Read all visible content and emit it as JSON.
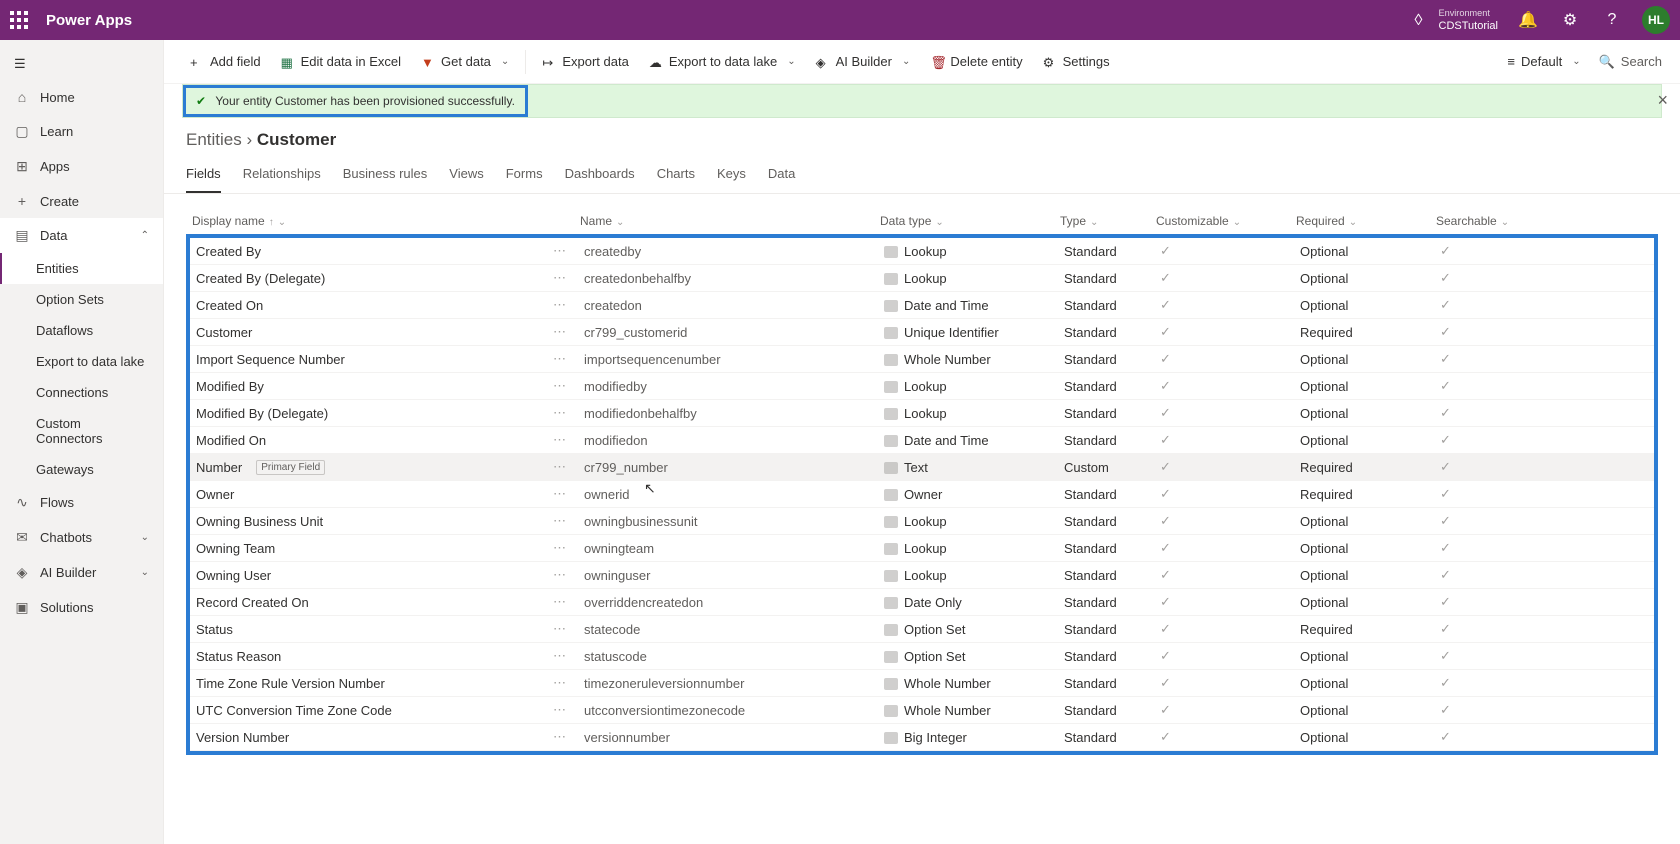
{
  "header": {
    "app_title": "Power Apps",
    "env_label": "Environment",
    "env_name": "CDSTutorial",
    "avatar": "HL"
  },
  "sidebar": {
    "items": [
      {
        "icon": "⌂",
        "label": "Home"
      },
      {
        "icon": "▢",
        "label": "Learn"
      },
      {
        "icon": "⊞",
        "label": "Apps"
      },
      {
        "icon": "+",
        "label": "Create"
      },
      {
        "icon": "▤",
        "label": "Data",
        "expanded": true
      },
      {
        "icon": "∿",
        "label": "Flows"
      },
      {
        "icon": "✉",
        "label": "Chatbots",
        "chev": true
      },
      {
        "icon": "◈",
        "label": "AI Builder",
        "chev": true
      },
      {
        "icon": "▣",
        "label": "Solutions"
      }
    ],
    "data_sub": [
      "Entities",
      "Option Sets",
      "Dataflows",
      "Export to data lake",
      "Connections",
      "Custom Connectors",
      "Gateways"
    ]
  },
  "cmd": {
    "add_field": "Add field",
    "edit_excel": "Edit data in Excel",
    "get_data": "Get data",
    "export_data": "Export data",
    "export_lake": "Export to data lake",
    "ai_builder": "AI Builder",
    "delete": "Delete entity",
    "settings": "Settings",
    "view": "Default",
    "search": "Search"
  },
  "notif": {
    "msg": "Your entity Customer has been provisioned successfully."
  },
  "crumbs": {
    "parent": "Entities",
    "current": "Customer"
  },
  "tabs": [
    "Fields",
    "Relationships",
    "Business rules",
    "Views",
    "Forms",
    "Dashboards",
    "Charts",
    "Keys",
    "Data"
  ],
  "cols": {
    "display": "Display name",
    "name": "Name",
    "datatype": "Data type",
    "type": "Type",
    "cust": "Customizable",
    "req": "Required",
    "search": "Searchable"
  },
  "primary_field": "Primary Field",
  "rows": [
    {
      "d": "Created By",
      "n": "createdby",
      "dt": "Lookup",
      "t": "Standard",
      "r": "Optional"
    },
    {
      "d": "Created By (Delegate)",
      "n": "createdonbehalfby",
      "dt": "Lookup",
      "t": "Standard",
      "r": "Optional"
    },
    {
      "d": "Created On",
      "n": "createdon",
      "dt": "Date and Time",
      "t": "Standard",
      "r": "Optional"
    },
    {
      "d": "Customer",
      "n": "cr799_customerid",
      "dt": "Unique Identifier",
      "t": "Standard",
      "r": "Required"
    },
    {
      "d": "Import Sequence Number",
      "n": "importsequencenumber",
      "dt": "Whole Number",
      "t": "Standard",
      "r": "Optional"
    },
    {
      "d": "Modified By",
      "n": "modifiedby",
      "dt": "Lookup",
      "t": "Standard",
      "r": "Optional"
    },
    {
      "d": "Modified By (Delegate)",
      "n": "modifiedonbehalfby",
      "dt": "Lookup",
      "t": "Standard",
      "r": "Optional"
    },
    {
      "d": "Modified On",
      "n": "modifiedon",
      "dt": "Date and Time",
      "t": "Standard",
      "r": "Optional"
    },
    {
      "d": "Number",
      "n": "cr799_number",
      "dt": "Text",
      "t": "Custom",
      "r": "Required",
      "pf": true,
      "hl": true
    },
    {
      "d": "Owner",
      "n": "ownerid",
      "dt": "Owner",
      "t": "Standard",
      "r": "Required"
    },
    {
      "d": "Owning Business Unit",
      "n": "owningbusinessunit",
      "dt": "Lookup",
      "t": "Standard",
      "r": "Optional"
    },
    {
      "d": "Owning Team",
      "n": "owningteam",
      "dt": "Lookup",
      "t": "Standard",
      "r": "Optional"
    },
    {
      "d": "Owning User",
      "n": "owninguser",
      "dt": "Lookup",
      "t": "Standard",
      "r": "Optional"
    },
    {
      "d": "Record Created On",
      "n": "overriddencreatedon",
      "dt": "Date Only",
      "t": "Standard",
      "r": "Optional"
    },
    {
      "d": "Status",
      "n": "statecode",
      "dt": "Option Set",
      "t": "Standard",
      "r": "Required"
    },
    {
      "d": "Status Reason",
      "n": "statuscode",
      "dt": "Option Set",
      "t": "Standard",
      "r": "Optional"
    },
    {
      "d": "Time Zone Rule Version Number",
      "n": "timezoneruleversionnumber",
      "dt": "Whole Number",
      "t": "Standard",
      "r": "Optional"
    },
    {
      "d": "UTC Conversion Time Zone Code",
      "n": "utcconversiontimezonecode",
      "dt": "Whole Number",
      "t": "Standard",
      "r": "Optional"
    },
    {
      "d": "Version Number",
      "n": "versionnumber",
      "dt": "Big Integer",
      "t": "Standard",
      "r": "Optional"
    }
  ]
}
